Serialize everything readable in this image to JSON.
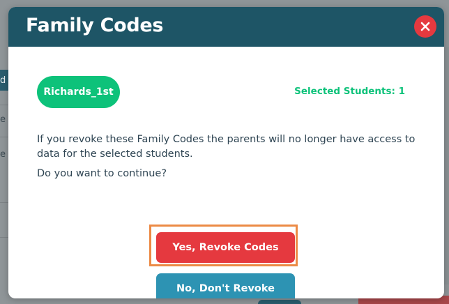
{
  "background": {
    "left_fragments": [
      "d",
      "e",
      "e"
    ]
  },
  "modal": {
    "title": "Family Codes",
    "close_icon": "close-icon",
    "student_chip": "Richards_1st",
    "selected_count": "Selected Students: 1",
    "warning": "If you revoke these Family Codes the parents will no longer have access to data for the selected students.",
    "question": "Do you want to continue?",
    "revoke_button": "Yes, Revoke Codes",
    "cancel_button": "No, Don't Revoke"
  },
  "colors": {
    "header": "#1e5566",
    "accent_green": "#0dc27a",
    "danger_red": "#e5393f",
    "secondary_blue": "#2d93b3",
    "highlight_orange": "#ec8a45"
  }
}
